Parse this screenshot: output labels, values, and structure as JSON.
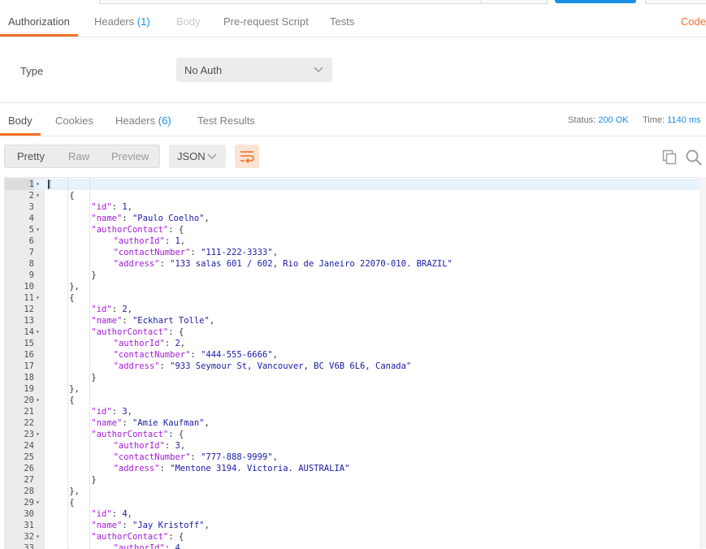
{
  "request_tabs": {
    "authorization": "Authorization",
    "headers": "Headers",
    "headers_count": "(1)",
    "body": "Body",
    "prerequest": "Pre-request Script",
    "tests": "Tests",
    "code": "Code"
  },
  "auth": {
    "type_label": "Type",
    "type_value": "No Auth"
  },
  "response_tabs": {
    "body": "Body",
    "cookies": "Cookies",
    "headers": "Headers",
    "headers_count": "(6)",
    "test_results": "Test Results"
  },
  "status": {
    "status_label": "Status:",
    "status_value": "200 OK",
    "time_label": "Time:",
    "time_value": "1140 ms"
  },
  "toolbar": {
    "pretty": "Pretty",
    "raw": "Raw",
    "preview": "Preview",
    "format": "JSON"
  },
  "colors": {
    "accent": "#f47023",
    "link": "#1b8fe3",
    "key": "#a31ad7",
    "string": "#1a1aa6"
  },
  "icons": {
    "dropdown": "chevron-down-icon",
    "wrap": "wrap-lines-icon",
    "copy": "copy-icon",
    "search": "search-icon",
    "fold": "fold-arrow-icon"
  },
  "code_lines": [
    {
      "n": "1",
      "fold": true,
      "indent": 0,
      "segs": [
        [
          "p",
          "["
        ]
      ]
    },
    {
      "n": "2",
      "fold": true,
      "indent": 1,
      "segs": [
        [
          "p",
          "{"
        ]
      ]
    },
    {
      "n": "3",
      "fold": false,
      "indent": 2,
      "segs": [
        [
          "k",
          "\"id\""
        ],
        [
          "p",
          ": "
        ],
        [
          "n",
          "1"
        ],
        [
          "p",
          ","
        ]
      ]
    },
    {
      "n": "4",
      "fold": false,
      "indent": 2,
      "segs": [
        [
          "k",
          "\"name\""
        ],
        [
          "p",
          ": "
        ],
        [
          "s",
          "\"Paulo Coelho\""
        ],
        [
          "p",
          ","
        ]
      ]
    },
    {
      "n": "5",
      "fold": true,
      "indent": 2,
      "segs": [
        [
          "k",
          "\"authorContact\""
        ],
        [
          "p",
          ": {"
        ]
      ]
    },
    {
      "n": "6",
      "fold": false,
      "indent": 3,
      "segs": [
        [
          "k",
          "\"authorId\""
        ],
        [
          "p",
          ": "
        ],
        [
          "n",
          "1"
        ],
        [
          "p",
          ","
        ]
      ]
    },
    {
      "n": "7",
      "fold": false,
      "indent": 3,
      "segs": [
        [
          "k",
          "\"contactNumber\""
        ],
        [
          "p",
          ": "
        ],
        [
          "s",
          "\"111-222-3333\""
        ],
        [
          "p",
          ","
        ]
      ]
    },
    {
      "n": "8",
      "fold": false,
      "indent": 3,
      "segs": [
        [
          "k",
          "\"address\""
        ],
        [
          "p",
          ": "
        ],
        [
          "s",
          "\"133 salas 601 / 602, Rio de Janeiro 22070-010. BRAZIL\""
        ]
      ]
    },
    {
      "n": "9",
      "fold": false,
      "indent": 2,
      "segs": [
        [
          "p",
          "}"
        ]
      ]
    },
    {
      "n": "10",
      "fold": false,
      "indent": 1,
      "segs": [
        [
          "p",
          "},"
        ]
      ]
    },
    {
      "n": "11",
      "fold": true,
      "indent": 1,
      "segs": [
        [
          "p",
          "{"
        ]
      ]
    },
    {
      "n": "12",
      "fold": false,
      "indent": 2,
      "segs": [
        [
          "k",
          "\"id\""
        ],
        [
          "p",
          ": "
        ],
        [
          "n",
          "2"
        ],
        [
          "p",
          ","
        ]
      ]
    },
    {
      "n": "13",
      "fold": false,
      "indent": 2,
      "segs": [
        [
          "k",
          "\"name\""
        ],
        [
          "p",
          ": "
        ],
        [
          "s",
          "\"Eckhart Tolle\""
        ],
        [
          "p",
          ","
        ]
      ]
    },
    {
      "n": "14",
      "fold": true,
      "indent": 2,
      "segs": [
        [
          "k",
          "\"authorContact\""
        ],
        [
          "p",
          ": {"
        ]
      ]
    },
    {
      "n": "15",
      "fold": false,
      "indent": 3,
      "segs": [
        [
          "k",
          "\"authorId\""
        ],
        [
          "p",
          ": "
        ],
        [
          "n",
          "2"
        ],
        [
          "p",
          ","
        ]
      ]
    },
    {
      "n": "16",
      "fold": false,
      "indent": 3,
      "segs": [
        [
          "k",
          "\"contactNumber\""
        ],
        [
          "p",
          ": "
        ],
        [
          "s",
          "\"444-555-6666\""
        ],
        [
          "p",
          ","
        ]
      ]
    },
    {
      "n": "17",
      "fold": false,
      "indent": 3,
      "segs": [
        [
          "k",
          "\"address\""
        ],
        [
          "p",
          ": "
        ],
        [
          "s",
          "\"933 Seymour St, Vancouver, BC V6B 6L6, Canada\""
        ]
      ]
    },
    {
      "n": "18",
      "fold": false,
      "indent": 2,
      "segs": [
        [
          "p",
          "}"
        ]
      ]
    },
    {
      "n": "19",
      "fold": false,
      "indent": 1,
      "segs": [
        [
          "p",
          "},"
        ]
      ]
    },
    {
      "n": "20",
      "fold": true,
      "indent": 1,
      "segs": [
        [
          "p",
          "{"
        ]
      ]
    },
    {
      "n": "21",
      "fold": false,
      "indent": 2,
      "segs": [
        [
          "k",
          "\"id\""
        ],
        [
          "p",
          ": "
        ],
        [
          "n",
          "3"
        ],
        [
          "p",
          ","
        ]
      ]
    },
    {
      "n": "22",
      "fold": false,
      "indent": 2,
      "segs": [
        [
          "k",
          "\"name\""
        ],
        [
          "p",
          ": "
        ],
        [
          "s",
          "\"Amie Kaufman\""
        ],
        [
          "p",
          ","
        ]
      ]
    },
    {
      "n": "23",
      "fold": true,
      "indent": 2,
      "segs": [
        [
          "k",
          "\"authorContact\""
        ],
        [
          "p",
          ": {"
        ]
      ]
    },
    {
      "n": "24",
      "fold": false,
      "indent": 3,
      "segs": [
        [
          "k",
          "\"authorId\""
        ],
        [
          "p",
          ": "
        ],
        [
          "n",
          "3"
        ],
        [
          "p",
          ","
        ]
      ]
    },
    {
      "n": "25",
      "fold": false,
      "indent": 3,
      "segs": [
        [
          "k",
          "\"contactNumber\""
        ],
        [
          "p",
          ": "
        ],
        [
          "s",
          "\"777-888-9999\""
        ],
        [
          "p",
          ","
        ]
      ]
    },
    {
      "n": "26",
      "fold": false,
      "indent": 3,
      "segs": [
        [
          "k",
          "\"address\""
        ],
        [
          "p",
          ": "
        ],
        [
          "s",
          "\"Mentone 3194. Victoria. AUSTRALIA\""
        ]
      ]
    },
    {
      "n": "27",
      "fold": false,
      "indent": 2,
      "segs": [
        [
          "p",
          "}"
        ]
      ]
    },
    {
      "n": "28",
      "fold": false,
      "indent": 1,
      "segs": [
        [
          "p",
          "},"
        ]
      ]
    },
    {
      "n": "29",
      "fold": true,
      "indent": 1,
      "segs": [
        [
          "p",
          "{"
        ]
      ]
    },
    {
      "n": "30",
      "fold": false,
      "indent": 2,
      "segs": [
        [
          "k",
          "\"id\""
        ],
        [
          "p",
          ": "
        ],
        [
          "n",
          "4"
        ],
        [
          "p",
          ","
        ]
      ]
    },
    {
      "n": "31",
      "fold": false,
      "indent": 2,
      "segs": [
        [
          "k",
          "\"name\""
        ],
        [
          "p",
          ": "
        ],
        [
          "s",
          "\"Jay Kristoff\""
        ],
        [
          "p",
          ","
        ]
      ]
    },
    {
      "n": "32",
      "fold": true,
      "indent": 2,
      "segs": [
        [
          "k",
          "\"authorContact\""
        ],
        [
          "p",
          ": {"
        ]
      ]
    },
    {
      "n": "33",
      "fold": false,
      "indent": 3,
      "segs": [
        [
          "k",
          "\"authorId\""
        ],
        [
          "p",
          ": "
        ],
        [
          "n",
          "4"
        ]
      ]
    }
  ]
}
